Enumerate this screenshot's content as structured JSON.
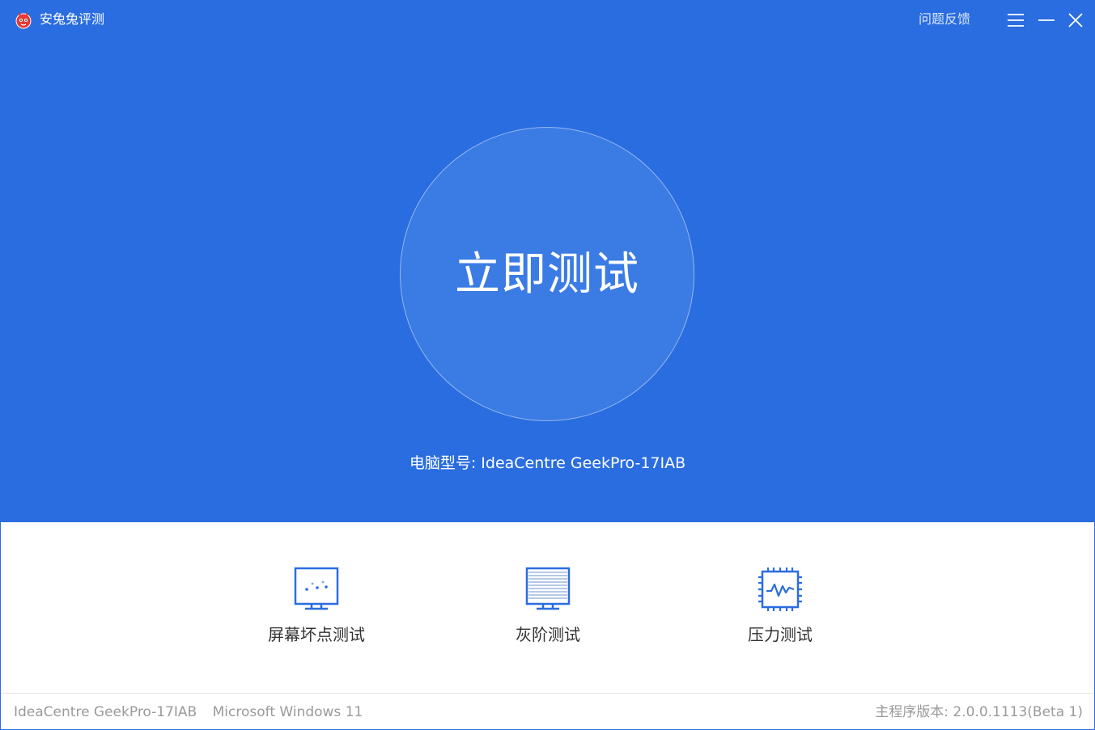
{
  "titlebar": {
    "app_title": "安兔兔评测",
    "logo_icon": "antutu-logo-icon",
    "feedback_label": "问题反馈",
    "menu_icon": "hamburger-menu-icon",
    "minimize_icon": "minimize-icon",
    "close_icon": "close-icon"
  },
  "main": {
    "start_button_label": "立即测试",
    "model_label": "电脑型号:",
    "model_value": "IdeaCentre GeekPro-17IAB"
  },
  "tools": [
    {
      "label": "屏幕坏点测试",
      "icon": "dead-pixel-monitor-icon"
    },
    {
      "label": "灰阶测试",
      "icon": "grayscale-monitor-icon"
    },
    {
      "label": "压力测试",
      "icon": "stress-chip-icon"
    }
  ],
  "statusbar": {
    "device": "IdeaCentre GeekPro-17IAB",
    "os": "Microsoft Windows 11",
    "version": "主程序版本: 2.0.0.1113(Beta 1)"
  },
  "colors": {
    "primary": "#2a6de0",
    "circle": "#3b7be4",
    "icon_blue": "#2a6de0",
    "status_text": "#9a9a9a"
  }
}
